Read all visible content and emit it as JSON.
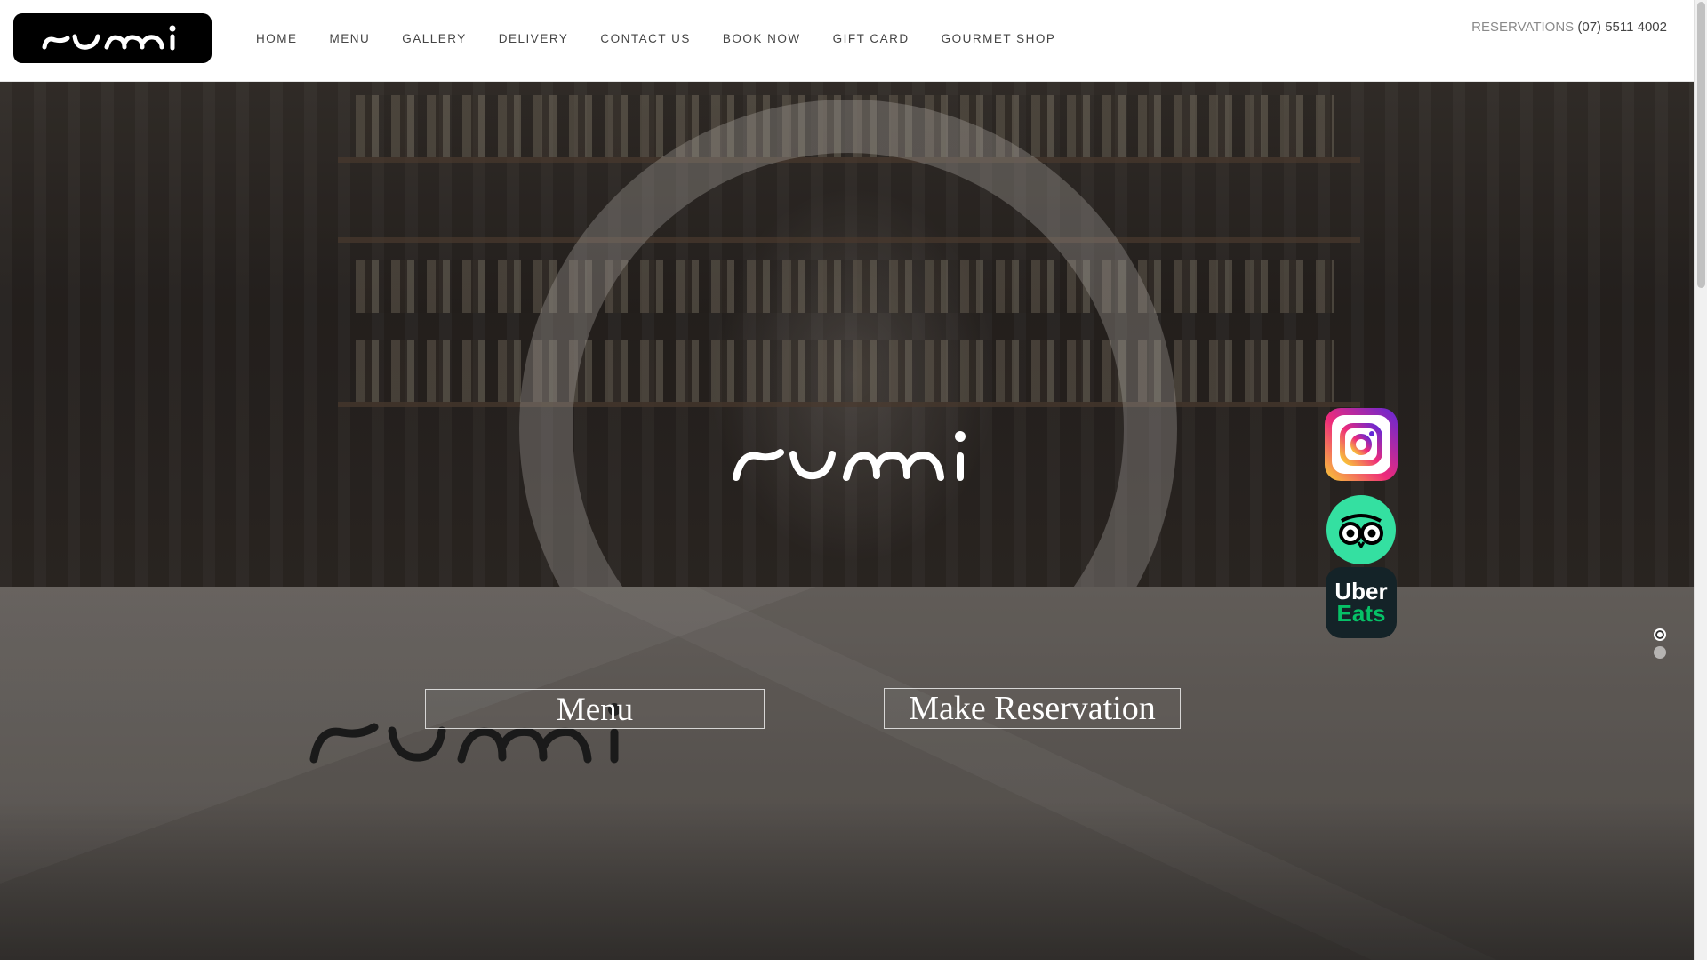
{
  "header": {
    "logo_text": "rumi",
    "nav": [
      {
        "label": "HOME"
      },
      {
        "label": "MENU"
      },
      {
        "label": "GALLERY"
      },
      {
        "label": "DELIVERY"
      },
      {
        "label": "CONTACT US"
      },
      {
        "label": "BOOK NOW"
      },
      {
        "label": "GIFT CARD"
      },
      {
        "label": "GOURMET SHOP"
      }
    ],
    "reservations_label": "RESERVATIONS",
    "reservations_phone": "(07) 5511 4002"
  },
  "hero": {
    "logo_text": "rumi",
    "buttons": {
      "menu": "Menu",
      "reserve": "Make Reservation"
    },
    "social": {
      "instagram_icon": "instagram-icon",
      "tripadvisor_icon": "tripadvisor-icon",
      "ubereats_top": "Uber",
      "ubereats_bottom": "Eats"
    },
    "slider": {
      "slide_count": 2,
      "active_index": 0
    }
  },
  "colors": {
    "nav_text": "#444444",
    "reservations_label": "#8a8a8a",
    "logo_bg": "#000000",
    "instagram": "#ee2a7b",
    "tripadvisor": "#34e0a1",
    "ubereats_bg": "#142328",
    "ubereats_green": "#06c167"
  }
}
